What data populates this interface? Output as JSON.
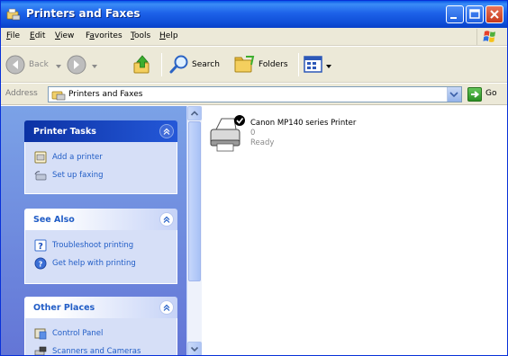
{
  "window": {
    "title": "Printers and Faxes"
  },
  "menu": {
    "items": [
      {
        "key": "F",
        "rest": "ile"
      },
      {
        "key": "E",
        "rest": "dit"
      },
      {
        "key": "V",
        "rest": "iew"
      },
      {
        "pre": "F",
        "key": "a",
        "rest": "vorites"
      },
      {
        "key": "T",
        "rest": "ools"
      },
      {
        "key": "H",
        "rest": "elp"
      }
    ]
  },
  "toolbar": {
    "back": "Back",
    "search": "Search",
    "folders": "Folders"
  },
  "address": {
    "label": "Address",
    "value": "Printers and Faxes",
    "go": "Go"
  },
  "taskpane": {
    "printer_tasks": {
      "title": "Printer Tasks",
      "items": [
        "Add a printer",
        "Set up faxing"
      ]
    },
    "see_also": {
      "title": "See Also",
      "items": [
        "Troubleshoot printing",
        "Get help with printing"
      ]
    },
    "other_places": {
      "title": "Other Places",
      "items": [
        "Control Panel",
        "Scanners and Cameras"
      ]
    }
  },
  "printers": [
    {
      "name": "Canon MP140 series Printer",
      "documents": "0",
      "status": "Ready"
    }
  ],
  "colors": {
    "title_bar": "#0f4fd8",
    "task_pane": "#6f8ddf",
    "link": "#215dc6"
  }
}
